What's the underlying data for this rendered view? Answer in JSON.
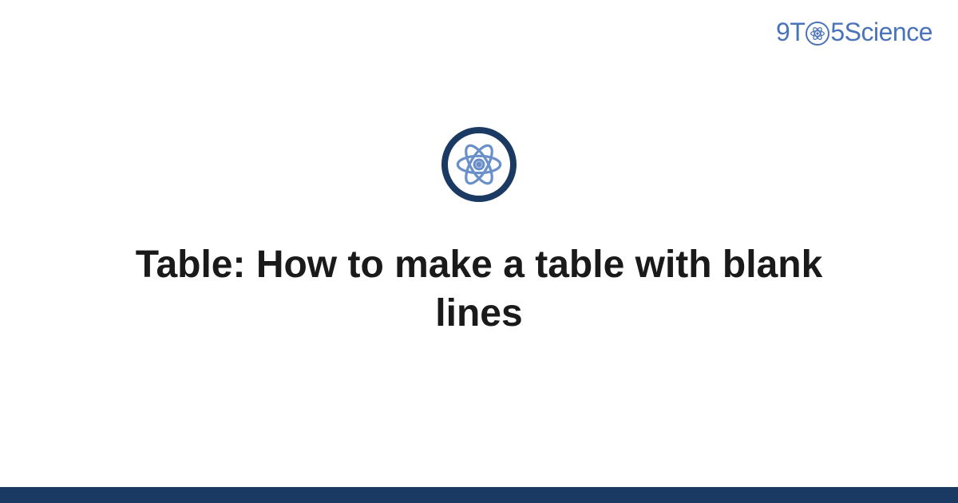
{
  "brand": {
    "prefix": "9T",
    "suffix_num": "5",
    "suffix_word": "Science"
  },
  "title": "Table: How to make a table with blank lines",
  "colors": {
    "brand_blue": "#4a74b8",
    "dark_navy": "#1a3a63",
    "text": "#1a1a1a"
  },
  "icon": {
    "name": "atom"
  }
}
